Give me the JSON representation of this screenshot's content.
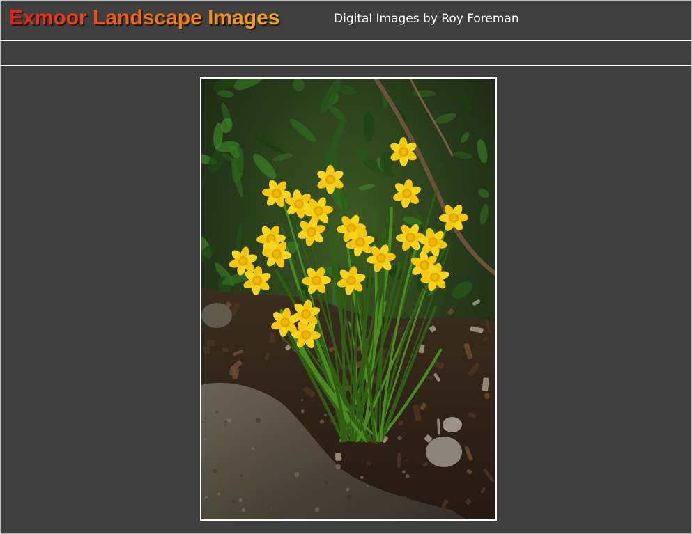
{
  "header": {
    "site_title": "Exmoor Landscape Images",
    "subtitle": "Digital Images by Roy Foreman"
  },
  "photo": {
    "subject": "daffodils",
    "colors": {
      "petal": "#f5c80e",
      "petal_dark": "#e0a800",
      "leaf": "#4a8a1e",
      "leaf_dark": "#2f5e12",
      "soil": "#3a2a1c",
      "rock": "#5a5448",
      "foliage": "#2d4a1a"
    }
  },
  "colors": {
    "background": "#3f3f3f",
    "divider": "#ffffff",
    "title_gradient_start": "#e81c10",
    "title_gradient_end": "#f6a818",
    "subtitle": "#ffffff"
  }
}
